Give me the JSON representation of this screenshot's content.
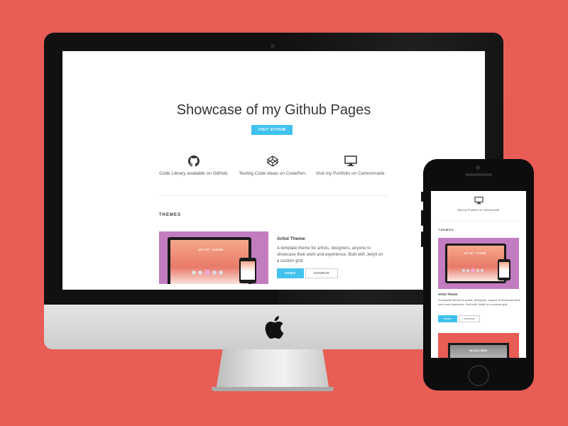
{
  "desktop": {
    "title": "Showcase of my Github Pages",
    "visit_button": "VISIT GITHUB",
    "features": [
      {
        "icon": "github-icon",
        "text": "Code Library available on GitHub."
      },
      {
        "icon": "codepen-icon",
        "text": "Testing Code Ideas on CodePen."
      },
      {
        "icon": "monitor-icon",
        "text": "Visit my Portfolio on Carbonmade."
      }
    ],
    "themes_label": "THEMES",
    "theme": {
      "thumb_text": "ARTIST THEME",
      "title": "Artist Theme",
      "description": "A template theme for artists, designers, anyone to showcase their work and experience. Built with Jekyll on a custom grid.",
      "demo": "DEMO",
      "source": "SOURCE"
    }
  },
  "mobile": {
    "feature_text": "Visit my Portfolio on Carbonmade.",
    "themes_label": "THEMES",
    "theme": {
      "thumb_text": "ARTIST THEME",
      "title": "Artist Theme",
      "description": "A template theme for artists, designers, anyone to showcase their work and experience. Built with Jekyll on a custom grid.",
      "demo": "DEMO",
      "source": "SOURCE"
    },
    "next_theme_text": "BLACK BIRD"
  },
  "colors": {
    "background": "#e85d55",
    "accent": "#3fc1ee",
    "theme_thumb": "#c27dc0"
  }
}
